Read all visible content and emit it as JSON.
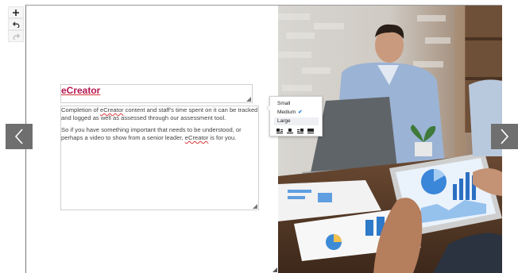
{
  "toolbar": {
    "add_icon": "plus-icon",
    "undo_icon": "undo-icon",
    "redo_icon": "redo-icon"
  },
  "content": {
    "title": "eCreator",
    "para1_before": "Completion of ",
    "para1_word": "eCreator",
    "para1_after": " content and staff's time spent on it can be tracked and logged as well as assessed through our assessment tool.",
    "para2_before": "So if you have something important that needs to be understood, or perhaps a video to show from a senior leader, ",
    "para2_word": "eCreator",
    "para2_after": "  is for you."
  },
  "size_menu": {
    "options": [
      "Small",
      "Medium",
      "Large"
    ],
    "selected": "Medium",
    "check": "✔",
    "align_icons": [
      "align-left-icon",
      "align-center-icon",
      "align-right-icon",
      "align-full-icon"
    ]
  },
  "nav": {
    "prev_icon": "chevron-left-icon",
    "next_icon": "chevron-right-icon"
  },
  "colors": {
    "title": "#b5174e",
    "nav_bg": "#6f6f6f",
    "check": "#2a7fd4"
  }
}
